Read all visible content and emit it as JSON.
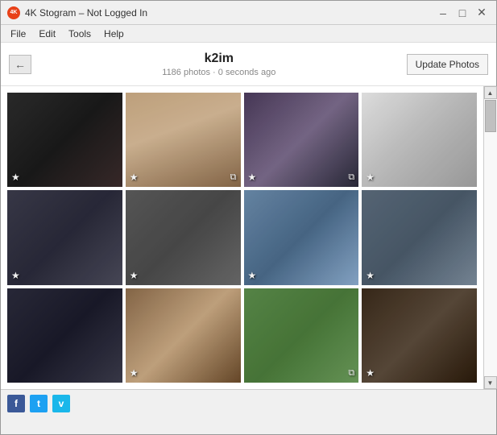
{
  "window": {
    "title": "4K Stogram – Not Logged In",
    "icon_label": "4K"
  },
  "titlebar_controls": {
    "minimize": "–",
    "maximize": "□",
    "close": "✕"
  },
  "menu": {
    "items": [
      "File",
      "Edit",
      "Tools",
      "Help"
    ]
  },
  "header": {
    "back_button": "←",
    "username": "k2im",
    "subtitle": "1186 photos · 0 seconds ago",
    "update_button": "Update Photos"
  },
  "photos": [
    {
      "id": 1,
      "style_class": "photo-1",
      "has_star": true,
      "has_badge": false
    },
    {
      "id": 2,
      "style_class": "photo-2",
      "has_star": true,
      "has_badge": true
    },
    {
      "id": 3,
      "style_class": "photo-3",
      "has_star": true,
      "has_badge": true
    },
    {
      "id": 4,
      "style_class": "photo-4",
      "has_star": true,
      "has_badge": false
    },
    {
      "id": 5,
      "style_class": "photo-5",
      "has_star": true,
      "has_badge": false
    },
    {
      "id": 6,
      "style_class": "photo-6",
      "has_star": true,
      "has_badge": false
    },
    {
      "id": 7,
      "style_class": "photo-7",
      "has_star": true,
      "has_badge": false
    },
    {
      "id": 8,
      "style_class": "photo-8",
      "has_star": true,
      "has_badge": false
    },
    {
      "id": 9,
      "style_class": "photo-9",
      "has_star": false,
      "has_badge": false
    },
    {
      "id": 10,
      "style_class": "photo-10",
      "has_star": true,
      "has_badge": false
    },
    {
      "id": 11,
      "style_class": "photo-11",
      "has_star": false,
      "has_badge": true
    },
    {
      "id": 12,
      "style_class": "photo-12",
      "has_star": true,
      "has_badge": false
    }
  ],
  "social_icons": {
    "facebook": "f",
    "twitter": "t",
    "vimeo": "v"
  },
  "scrollbar": {
    "up_arrow": "▲",
    "down_arrow": "▼"
  }
}
